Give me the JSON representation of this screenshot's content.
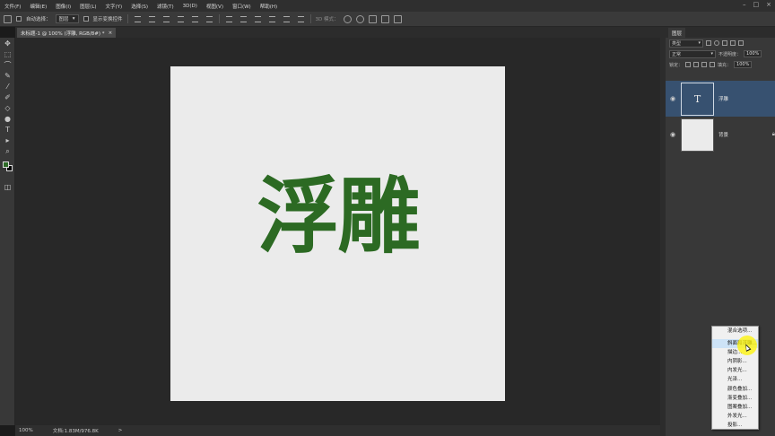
{
  "menubar": {
    "items": [
      "文件(F)",
      "编辑(E)",
      "图像(I)",
      "图层(L)",
      "文字(Y)",
      "选择(S)",
      "滤镜(T)",
      "3D(D)",
      "视图(V)",
      "窗口(W)",
      "帮助(H)"
    ],
    "window_controls": [
      "–",
      "□",
      "×"
    ]
  },
  "options": {
    "auto_select_label": "自动选择：",
    "auto_select_value": "图层",
    "show_transform_label": "显示变换控件",
    "mode_3d_label": "3D 模式："
  },
  "document": {
    "tab_title": "未标题-1 @ 100% (浮雕, RGB/8#) *",
    "close_glyph": "×",
    "canvas_text": "浮雕"
  },
  "colors": {
    "foreground": "#2e6b27",
    "background": "#000000",
    "text_color": "#2c6a23",
    "selected_layer": "#375170"
  },
  "status": {
    "zoom": "100%",
    "doc_info": "文档:1.83M/976.8K",
    "arrow": ">"
  },
  "layers_panel": {
    "tab_label": "图层",
    "filter_kind": "类型",
    "blend_mode": "正常",
    "opacity_label": "不透明度：",
    "opacity_value": "100%",
    "lock_label": "锁定：",
    "fill_label": "填充：",
    "fill_value": "100%",
    "layers": [
      {
        "name": "浮雕",
        "type": "text",
        "thumb_glyph": "T",
        "visible": true,
        "selected": true
      },
      {
        "name": "背景",
        "type": "background",
        "visible": true,
        "selected": false,
        "locked": true
      }
    ]
  },
  "context_menu": {
    "items": [
      "混合选项...",
      "斜面和浮雕...",
      "描边...",
      "内阴影...",
      "内发光...",
      "光泽...",
      "颜色叠加...",
      "渐变叠加...",
      "图案叠加...",
      "外发光...",
      "投影..."
    ],
    "highlighted_index": 1
  },
  "icons": {
    "eye": "eye-icon",
    "lock": "lock-icon",
    "move": "move-tool-icon"
  }
}
